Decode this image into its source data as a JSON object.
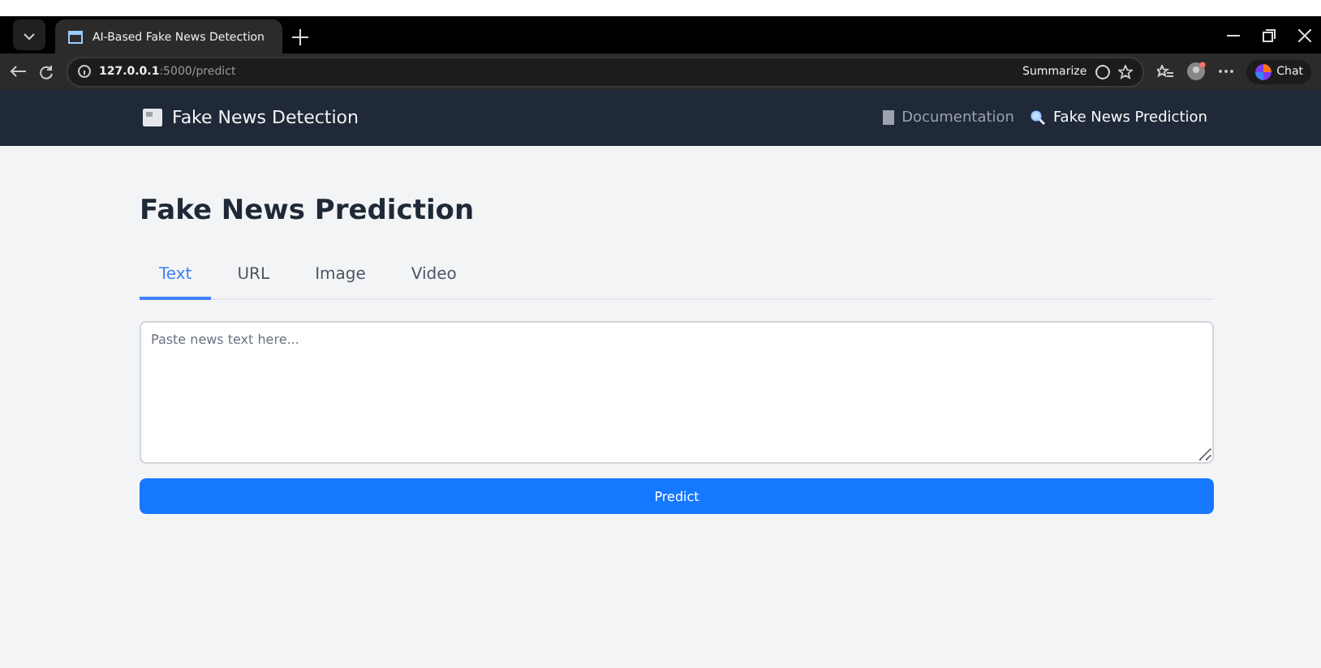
{
  "browser": {
    "tab_title": "AI-Based Fake News Detection",
    "url_host": "127.0.0.1",
    "url_path": ":5000/predict",
    "summarize": "Summarize",
    "chat": "Chat"
  },
  "navbar": {
    "brand": "Fake News Detection",
    "links": [
      {
        "label": "Documentation",
        "kind": "doc",
        "selected": false
      },
      {
        "label": "Fake News Prediction",
        "kind": "search",
        "selected": true
      }
    ]
  },
  "page": {
    "title": "Fake News Prediction",
    "tabs": [
      {
        "label": "Text",
        "selected": true
      },
      {
        "label": "URL",
        "selected": false
      },
      {
        "label": "Image",
        "selected": false
      },
      {
        "label": "Video",
        "selected": false
      }
    ],
    "input": {
      "placeholder": "Paste news text here..."
    },
    "button": "Predict"
  }
}
